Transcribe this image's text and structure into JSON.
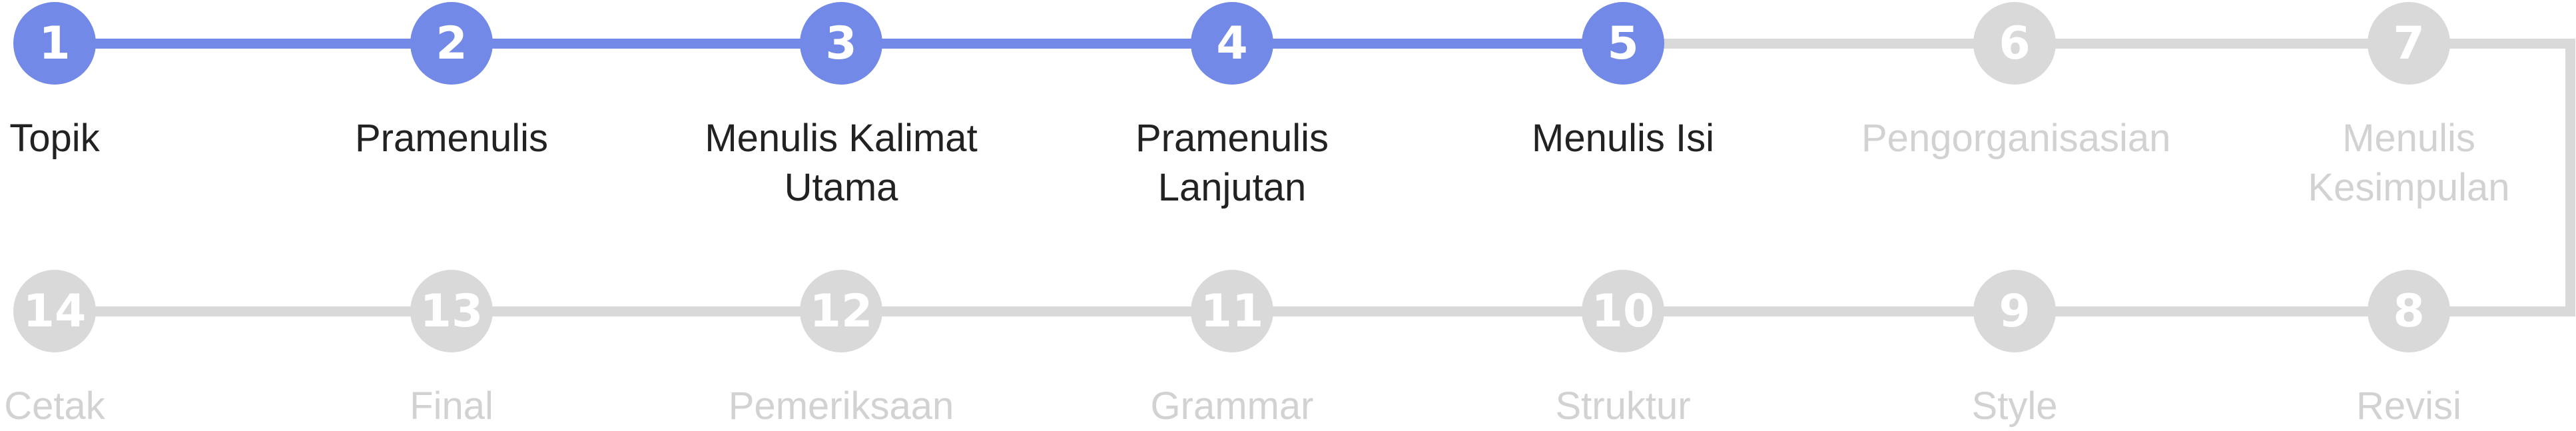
{
  "colors": {
    "active": "#7289e7",
    "inactive": "#d9d9d9",
    "active_text": "#222222",
    "inactive_text": "#d2d2d2"
  },
  "progress": {
    "current_step": 5,
    "total_steps": 14
  },
  "steps": [
    {
      "number": "1",
      "label": "Topik",
      "active": true
    },
    {
      "number": "2",
      "label": "Pramenulis",
      "active": true
    },
    {
      "number": "3",
      "label": "Menulis Kalimat\nUtama",
      "active": true
    },
    {
      "number": "4",
      "label": "Pramenulis\nLanjutan",
      "active": true
    },
    {
      "number": "5",
      "label": "Menulis Isi",
      "active": true
    },
    {
      "number": "6",
      "label": "Pengorganisasian",
      "active": false
    },
    {
      "number": "7",
      "label": "Menulis\nKesimpulan",
      "active": false
    },
    {
      "number": "8",
      "label": "Revisi",
      "active": false
    },
    {
      "number": "9",
      "label": "Style",
      "active": false
    },
    {
      "number": "10",
      "label": "Struktur",
      "active": false
    },
    {
      "number": "11",
      "label": "Grammar",
      "active": false
    },
    {
      "number": "12",
      "label": "Pemeriksaan",
      "active": false
    },
    {
      "number": "13",
      "label": "Final",
      "active": false
    },
    {
      "number": "14",
      "label": "Cetak",
      "active": false
    }
  ]
}
